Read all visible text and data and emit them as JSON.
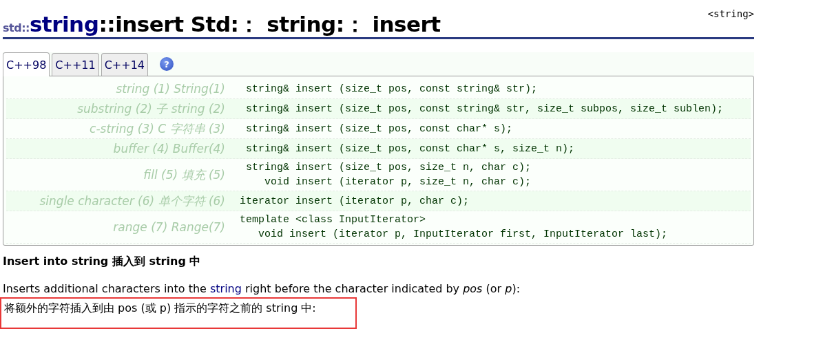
{
  "header": {
    "namespace": "std::",
    "class_name": "string",
    "title_rest": "::insert  Std:： string:： insert",
    "header_file": "<string>"
  },
  "tabs": [
    {
      "label": "C++98",
      "selected": true
    },
    {
      "label": "C++11",
      "selected": false
    },
    {
      "label": "C++14",
      "selected": false
    }
  ],
  "help": "?",
  "overloads": [
    {
      "label": "string (1)  String(1)",
      "code": [
        " string& insert (size_t pos, const string& str);"
      ]
    },
    {
      "label": "substring (2)  子 string (2)",
      "code": [
        " string& insert (size_t pos, const string& str, size_t subpos, size_t sublen);"
      ]
    },
    {
      "label": "c-string (3)  C 字符串 (3)",
      "code": [
        " string& insert (size_t pos, const char* s);"
      ]
    },
    {
      "label": "buffer (4)  Buffer(4)",
      "code": [
        " string& insert (size_t pos, const char* s, size_t n);"
      ]
    },
    {
      "label": "fill (5)  填充 (5)",
      "code": [
        " string& insert (size_t pos, size_t n, char c);",
        "    void insert (iterator p, size_t n, char c);"
      ]
    },
    {
      "label": "single character (6)  单个字符 (6)",
      "code": [
        "iterator insert (iterator p, char c);"
      ]
    },
    {
      "label": "range (7)  Range(7)",
      "code": [
        "template <class InputIterator>",
        "   void insert (iterator p, InputIterator first, InputIterator last);"
      ]
    }
  ],
  "summary": "Insert into string  插入到 string 中",
  "description": {
    "before": "Inserts additional characters into the ",
    "link": "string",
    "after": " right before the character indicated by *pos* (or *p*):"
  },
  "translation": "将额外的字符插入到由 pos (或 p) 指示的字符之前的 string 中:"
}
